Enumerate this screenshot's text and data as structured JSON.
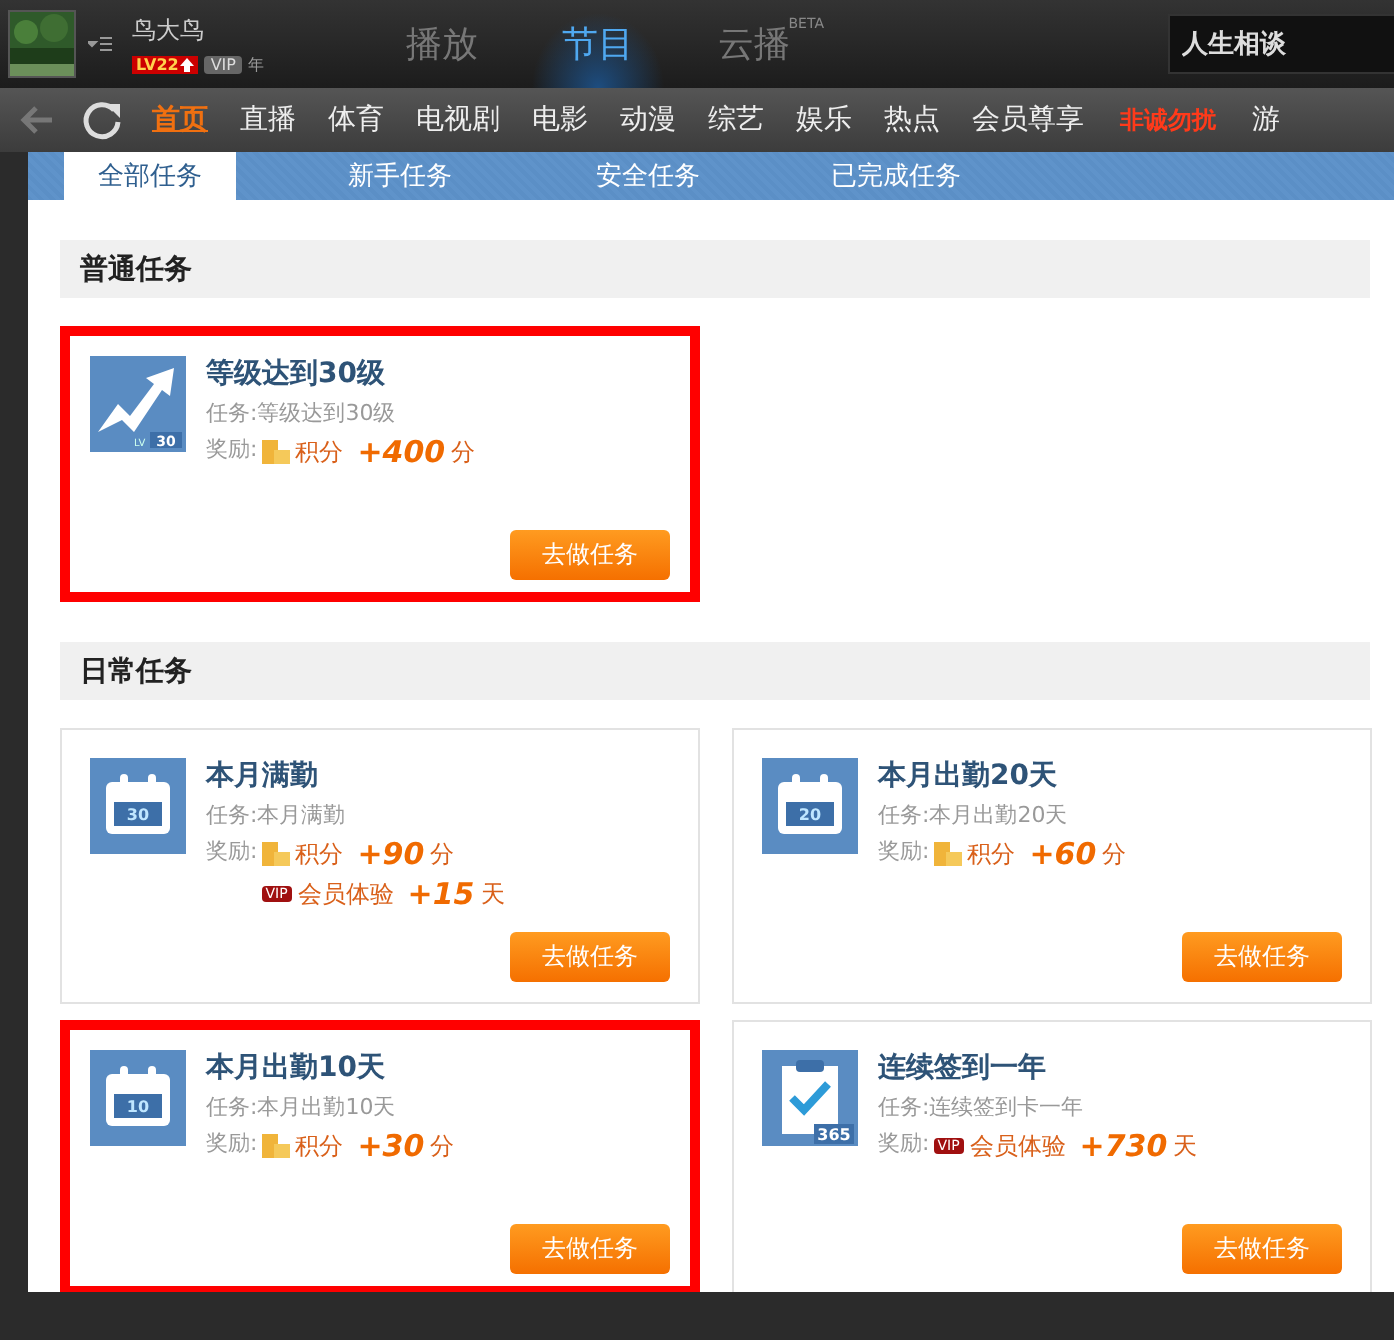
{
  "account": {
    "username": "鸟大鸟",
    "level_badge": "LV22",
    "vip_badge": "VIP",
    "vip_term": "年"
  },
  "main_tabs": [
    {
      "label": "播放",
      "selected": false
    },
    {
      "label": "节目",
      "selected": true
    },
    {
      "label": "云播",
      "selected": false,
      "superscript": "BETA"
    }
  ],
  "search": {
    "value": "人生相谈"
  },
  "nav": [
    {
      "label": "首页",
      "selected": true,
      "kind": "normal"
    },
    {
      "label": "直播",
      "selected": false,
      "kind": "normal"
    },
    {
      "label": "体育",
      "selected": false,
      "kind": "normal"
    },
    {
      "label": "电视剧",
      "selected": false,
      "kind": "normal"
    },
    {
      "label": "电影",
      "selected": false,
      "kind": "normal"
    },
    {
      "label": "动漫",
      "selected": false,
      "kind": "normal"
    },
    {
      "label": "综艺",
      "selected": false,
      "kind": "normal"
    },
    {
      "label": "娱乐",
      "selected": false,
      "kind": "normal"
    },
    {
      "label": "热点",
      "selected": false,
      "kind": "normal"
    },
    {
      "label": "会员尊享",
      "selected": false,
      "kind": "normal"
    },
    {
      "label": "非诚勿扰",
      "selected": false,
      "kind": "promo"
    },
    {
      "label": "游",
      "selected": false,
      "kind": "normal"
    }
  ],
  "task_tabs": [
    {
      "label": "全部任务",
      "selected": true
    },
    {
      "label": "新手任务",
      "selected": false
    },
    {
      "label": "安全任务",
      "selected": false
    },
    {
      "label": "已完成任务",
      "selected": false
    }
  ],
  "sections": [
    {
      "title": "普通任务",
      "tasks": [
        {
          "title": "等级达到30级",
          "task": "任务:等级达到30级",
          "reward_label": "奖励:",
          "kind": "level",
          "icon_prefix": "LV",
          "icon_label": "30",
          "highlighted": true,
          "button": "去做任务",
          "rewards": [
            {
              "kind": "points",
              "name": "积分",
              "amount": "+400",
              "unit": "分"
            }
          ]
        }
      ]
    },
    {
      "title": "日常任务",
      "tasks": [
        {
          "title": "本月满勤",
          "task": "任务:本月满勤",
          "reward_label": "奖励:",
          "kind": "calendar",
          "icon_label": "30",
          "highlighted": false,
          "button": "去做任务",
          "rewards": [
            {
              "kind": "points",
              "name": "积分",
              "amount": "+90",
              "unit": "分"
            },
            {
              "kind": "vip",
              "badge": "VIP",
              "name": "会员体验",
              "amount": "+15",
              "unit": "天"
            }
          ]
        },
        {
          "title": "本月出勤20天",
          "task": "任务:本月出勤20天",
          "reward_label": "奖励:",
          "kind": "calendar",
          "icon_label": "20",
          "highlighted": false,
          "button": "去做任务",
          "rewards": [
            {
              "kind": "points",
              "name": "积分",
              "amount": "+60",
              "unit": "分"
            }
          ]
        },
        {
          "title": "本月出勤10天",
          "task": "任务:本月出勤10天",
          "reward_label": "奖励:",
          "kind": "calendar",
          "icon_label": "10",
          "highlighted": true,
          "button": "去做任务",
          "rewards": [
            {
              "kind": "points",
              "name": "积分",
              "amount": "+30",
              "unit": "分"
            }
          ]
        },
        {
          "title": "连续签到一年",
          "task": "任务:连续签到卡一年",
          "reward_label": "奖励:",
          "kind": "clipboard",
          "icon_label": "365",
          "highlighted": false,
          "button": "去做任务",
          "rewards": [
            {
              "kind": "vip",
              "badge": "VIP",
              "name": "会员体验",
              "amount": "+730",
              "unit": "天"
            }
          ]
        }
      ]
    }
  ]
}
